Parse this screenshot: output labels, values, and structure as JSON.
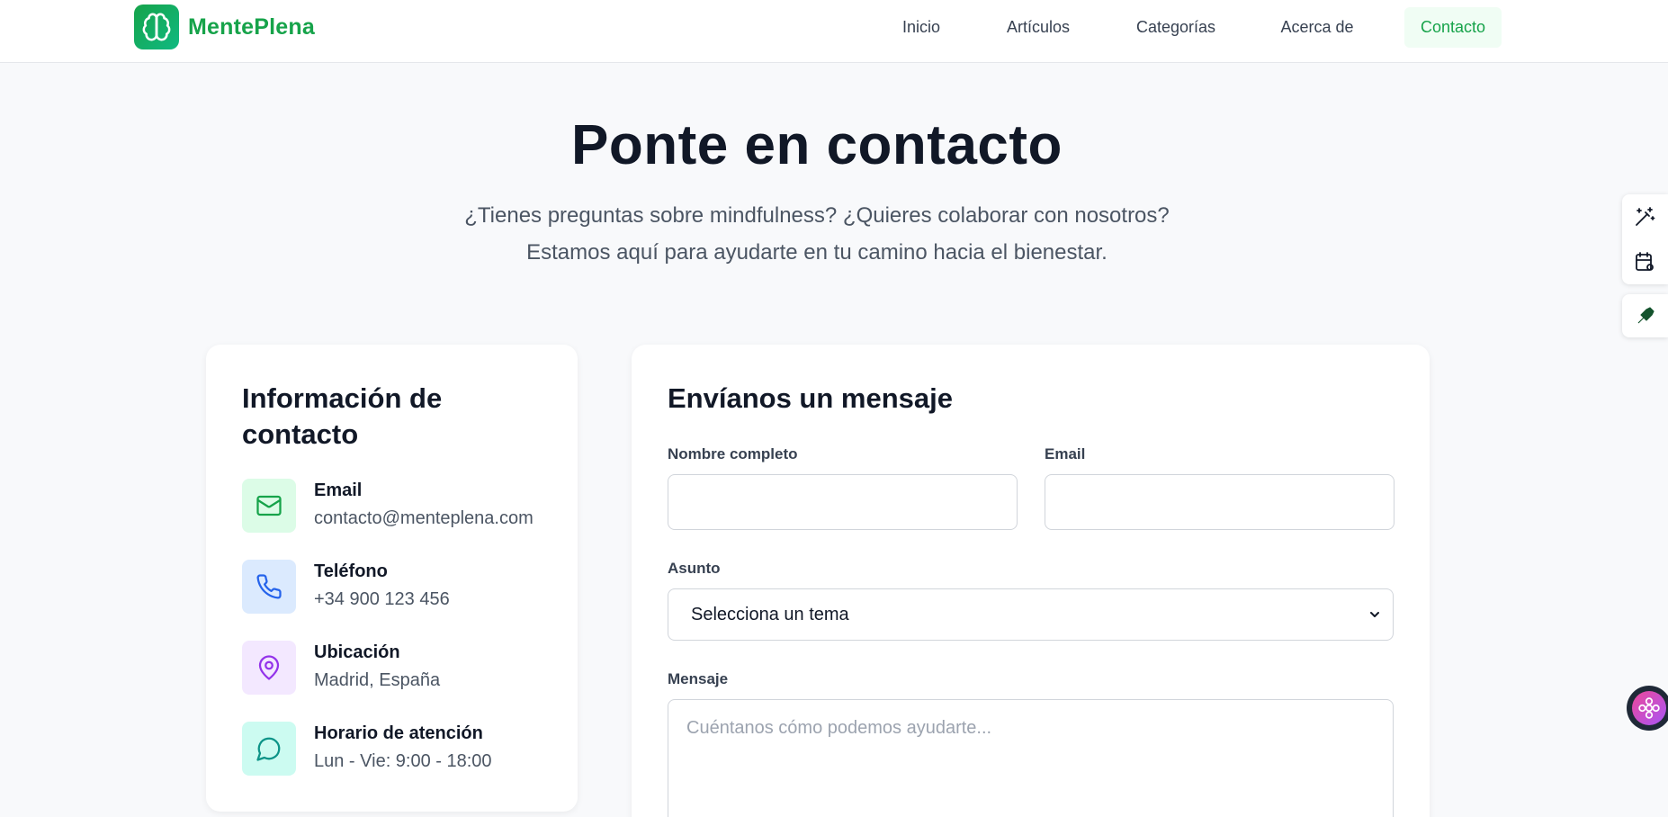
{
  "header": {
    "brand": "MentePlena",
    "nav": [
      {
        "label": "Inicio",
        "active": false
      },
      {
        "label": "Artículos",
        "active": false
      },
      {
        "label": "Categorías",
        "active": false
      },
      {
        "label": "Acerca de",
        "active": false
      },
      {
        "label": "Contacto",
        "active": true
      }
    ]
  },
  "hero": {
    "title": "Ponte en contacto",
    "subtitle_line1": "¿Tienes preguntas sobre mindfulness? ¿Quieres colaborar con nosotros?",
    "subtitle_line2": "Estamos aquí para ayudarte en tu camino hacia el bienestar."
  },
  "contact_info": {
    "title_line1": "Información de",
    "title_line2": "contacto",
    "items": [
      {
        "label": "Email",
        "value": "contacto@menteplena.com",
        "icon": "mail-icon",
        "color": "#16a34a",
        "bg": "#dcfce7"
      },
      {
        "label": "Teléfono",
        "value": "+34 900 123 456",
        "icon": "phone-icon",
        "color": "#2563eb",
        "bg": "#dbeafe"
      },
      {
        "label": "Ubicación",
        "value": "Madrid, España",
        "icon": "map-pin-icon",
        "color": "#9333ea",
        "bg": "#f3e8ff"
      },
      {
        "label": "Horario de atención",
        "value": "Lun - Vie: 9:00 - 18:00",
        "icon": "message-circle-icon",
        "color": "#0d9488",
        "bg": "#ccfbf1"
      }
    ]
  },
  "form": {
    "title": "Envíanos un mensaje",
    "name_label": "Nombre completo",
    "name_value": "",
    "email_label": "Email",
    "email_value": "",
    "subject_label": "Asunto",
    "subject_selected": "Selecciona un tema",
    "message_label": "Mensaje",
    "message_placeholder": "Cuéntanos cómo podemos ayudarte..."
  },
  "colors": {
    "brand": "#16a34a",
    "background": "#f8f9fb",
    "card": "#ffffff",
    "text": "#111827",
    "muted": "#4b5563"
  }
}
